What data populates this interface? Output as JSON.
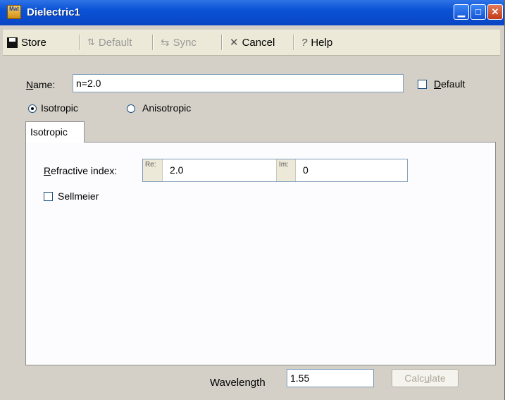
{
  "window": {
    "title": "Dielectric1",
    "app_icon_text": "Mat"
  },
  "toolbar": {
    "store_label": "Store",
    "default_label": "Default",
    "sync_label": "Sync",
    "cancel_label": "Cancel",
    "help_label": "Help"
  },
  "form": {
    "name_label_u": "N",
    "name_label_rest": "ame:",
    "name_value": "n=2.0",
    "default_checkbox_u": "D",
    "default_checkbox_rest": "efault",
    "default_checked": false,
    "radio_isotropic": "Isotropic",
    "radio_anisotropic": "Anisotropic",
    "selected_mode": "Isotropic"
  },
  "tabs": [
    {
      "label": "Isotropic",
      "active": true
    }
  ],
  "isotropic_panel": {
    "refractive_label_u": "R",
    "refractive_label_rest": "efractive index:",
    "re_tag": "Re:",
    "re_value": "2.0",
    "im_tag": "Im:",
    "im_value": "0",
    "sellmeier_label": "Sellmeier",
    "sellmeier_checked": false
  },
  "footer": {
    "wavelength_label": "Wavelength",
    "wavelength_value": "1.55",
    "calc_pre": "Calc",
    "calc_u": "u",
    "calc_post": "late"
  },
  "colors": {
    "titlebar": "#0a52d6",
    "window_bg": "#d4d0c8",
    "disabled_text": "#9a9a9a"
  }
}
